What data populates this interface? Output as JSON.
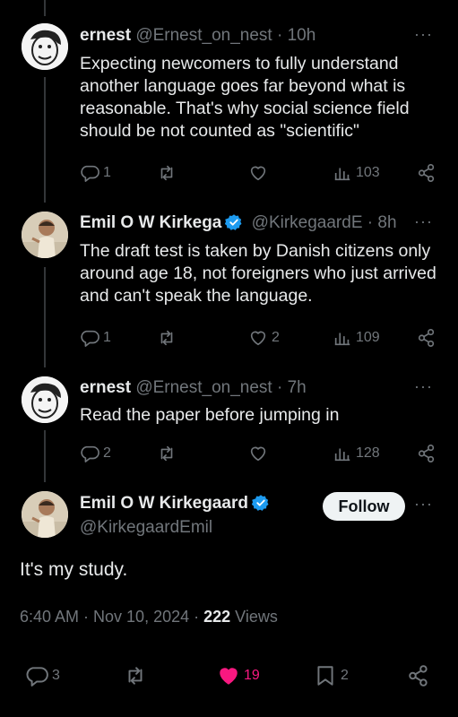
{
  "tweets": [
    {
      "name": "ernest",
      "handle": "@Ernest_on_nest",
      "time": "· 10h",
      "verified": false,
      "text": "Expecting newcomers to fully understand another language goes far beyond what is reasonable. That's why social science field should be not counted as \"scientific\"",
      "replies": "1",
      "retweets": "",
      "likes": "",
      "views": "103"
    },
    {
      "name": "Emil O W Kirkega",
      "handle": "@KirkegaardE",
      "time": "· 8h",
      "verified": true,
      "text": "The draft test is taken by Danish citizens only around age 18, not foreigners who just arrived and can't speak the language.",
      "replies": "1",
      "retweets": "",
      "likes": "2",
      "views": "109"
    },
    {
      "name": "ernest",
      "handle": "@Ernest_on_nest",
      "time": "· 7h",
      "verified": false,
      "text": "Read the paper before jumping in",
      "replies": "2",
      "retweets": "",
      "likes": "",
      "views": "128"
    }
  ],
  "main": {
    "name": "Emil O W Kirkegaard",
    "handle": "@KirkegaardEmil",
    "follow_label": "Follow",
    "text": "It's my study.",
    "timestamp": "6:40 AM · Nov 10, 2024 · ",
    "views_count": "222",
    "views_label": " Views",
    "replies": "3",
    "retweets": "",
    "likes": "19",
    "bookmarks": "2"
  },
  "more_label": "···",
  "colors": {
    "verified": "#1d9bf0",
    "like": "#f91880",
    "muted": "#71767b"
  }
}
